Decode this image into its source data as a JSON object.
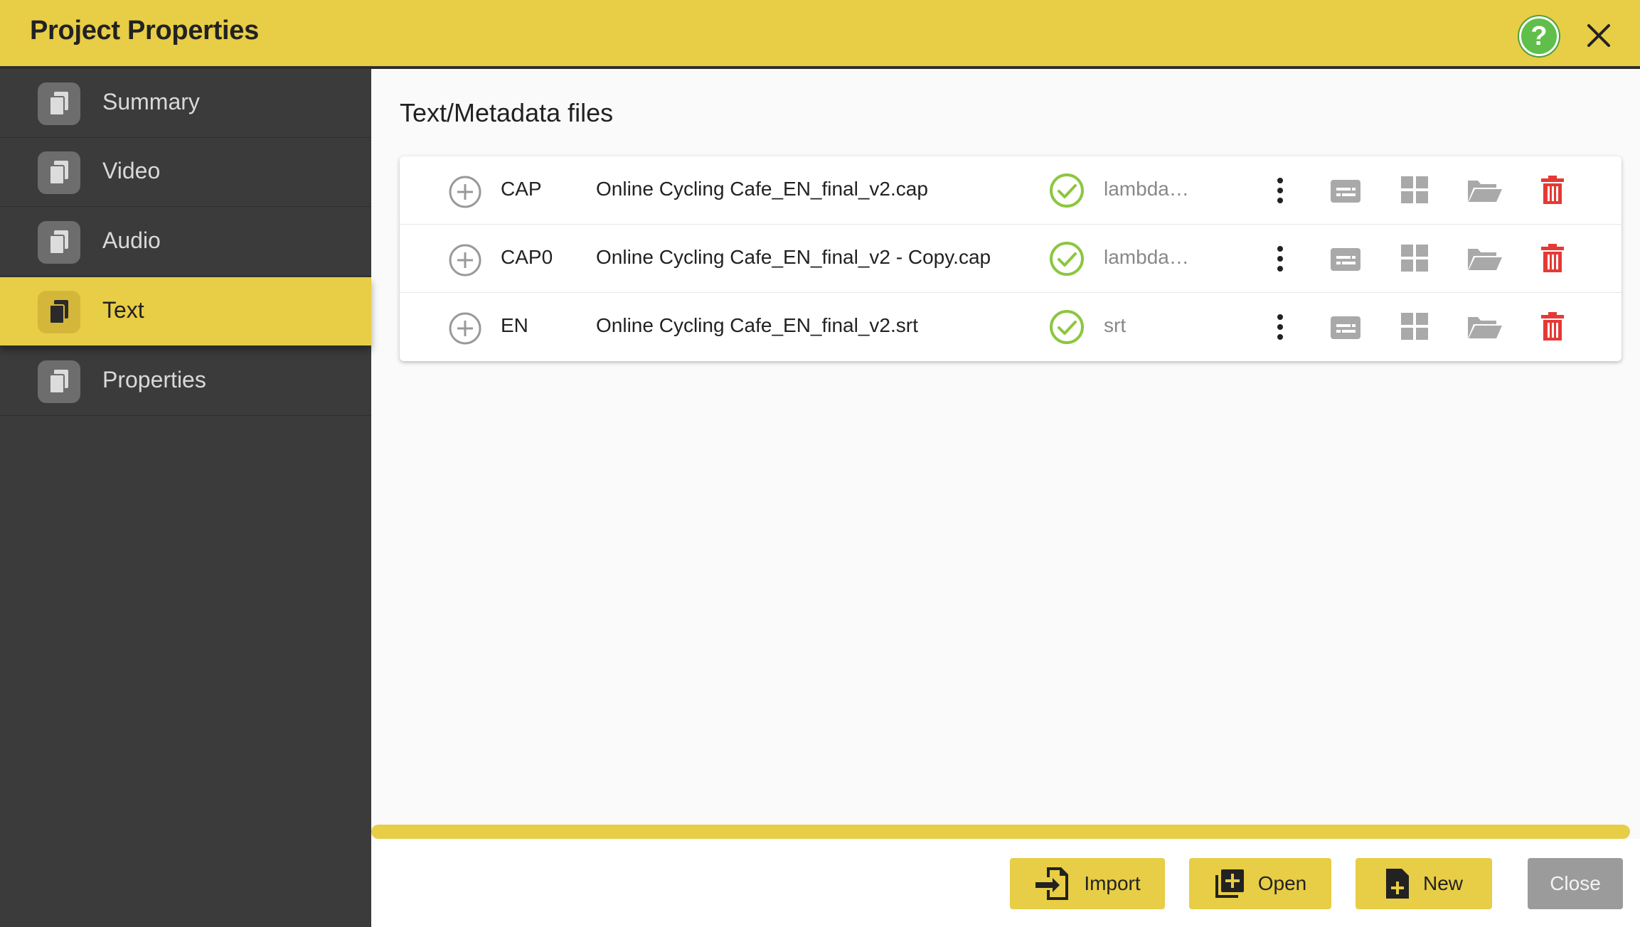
{
  "window": {
    "title": "Project Properties"
  },
  "sidebar": {
    "items": [
      {
        "label": "Summary",
        "icon": "copy-icon",
        "active": false
      },
      {
        "label": "Video",
        "icon": "copy-icon",
        "active": false
      },
      {
        "label": "Audio",
        "icon": "copy-icon",
        "active": false
      },
      {
        "label": "Text",
        "icon": "copy-icon",
        "active": true
      },
      {
        "label": "Properties",
        "icon": "copy-icon",
        "active": false
      }
    ]
  },
  "main": {
    "heading": "Text/Metadata files",
    "files": [
      {
        "code": "CAP",
        "name": "Online Cycling Cafe_EN_final_v2.cap",
        "format": "lambda…",
        "status": "ok"
      },
      {
        "code": "CAP0",
        "name": "Online Cycling Cafe_EN_final_v2 - Copy.cap",
        "format": "lambda…",
        "status": "ok"
      },
      {
        "code": "EN",
        "name": "Online Cycling Cafe_EN_final_v2.srt",
        "format": "srt",
        "status": "ok"
      }
    ]
  },
  "progress": {
    "value": 1.0
  },
  "footer": {
    "import_label": "Import",
    "open_label": "Open",
    "new_label": "New",
    "close_label": "Close"
  },
  "colors": {
    "accent": "#e8cd46",
    "sidebar_bg": "#3c3b3c",
    "check_green": "#8cc63f",
    "delete_red": "#e53935",
    "help_green": "#5fbf4a"
  }
}
